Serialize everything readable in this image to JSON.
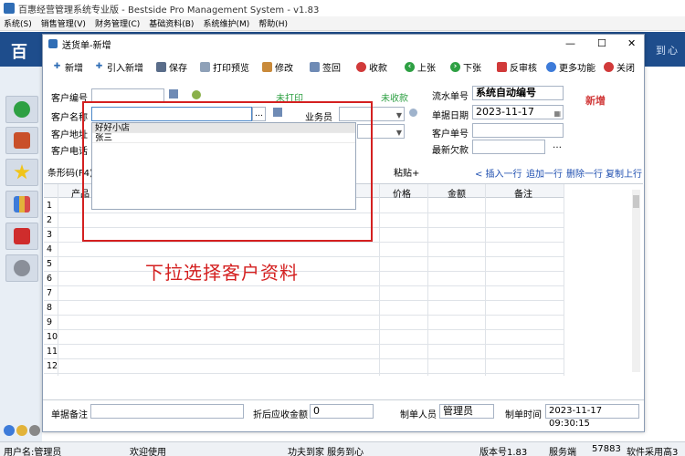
{
  "app": {
    "title": "百惠经营管理系统专业版 - Bestside Pro Management System - v1.83",
    "brand": "百",
    "brand_right": "到心",
    "menus": [
      "系统(S)",
      "销售管理(V)",
      "财务管理(C)",
      "基础资料(B)",
      "系统维护(M)",
      "帮助(H)"
    ]
  },
  "statusbar": {
    "user": "用户名:管理员",
    "welcome": "欢迎使用",
    "slogan": "功夫到家 服务到心",
    "version": "版本号1.83",
    "mode": "服务端",
    "port": "57883",
    "tail": "软件采用高3"
  },
  "dialog": {
    "title": "送货单-新增",
    "toolbar": {
      "add": "新增",
      "import_add": "引入新增",
      "save": "保存",
      "print_preview": "打印预览",
      "edit": "修改",
      "sign": "签回",
      "receive": "收款",
      "prev": "上张",
      "next": "下张",
      "unaudit": "反审核",
      "more": "更多功能",
      "close": "关闭"
    },
    "form": {
      "customer_code_label": "客户编号",
      "customer_name_label": "客户名称",
      "customer_addr_label": "客户地址",
      "customer_phone_label": "客户电话",
      "status_print": "未打印",
      "status_receive": "未收款",
      "salesman_label": "业务员",
      "flow_no_label": "流水单号",
      "flow_no_value": "系统自动编号",
      "date_label": "单据日期",
      "date_value": "2023-11-17",
      "cust_order_label": "客户单号",
      "latest_debt_label": "最新欠款",
      "mode_badge": "新增",
      "barcode_label": "条形码(F4)",
      "paste": "粘贴+",
      "insert_row": "< 插入一行",
      "append_row": "追加一行",
      "delete_row": "删除一行",
      "copy_row": "复制上行"
    },
    "dropdown": {
      "items": [
        "好好小店",
        "张三"
      ]
    },
    "grid": {
      "headers": [
        "产品",
        "价格",
        "金额",
        "备注"
      ],
      "rows": [
        "1",
        "2",
        "3",
        "4",
        "5",
        "6",
        "7",
        "8",
        "9",
        "10",
        "11",
        "12"
      ]
    },
    "footer": {
      "remark_label": "单据备注",
      "discount_label": "折后应收金额",
      "discount_value": "0",
      "maker_label": "制单人员",
      "maker_value": "管理员",
      "make_time_label": "制单时间",
      "make_time_value": "2023-11-17 09:30:15"
    },
    "annotation": "下拉选择客户资料"
  }
}
